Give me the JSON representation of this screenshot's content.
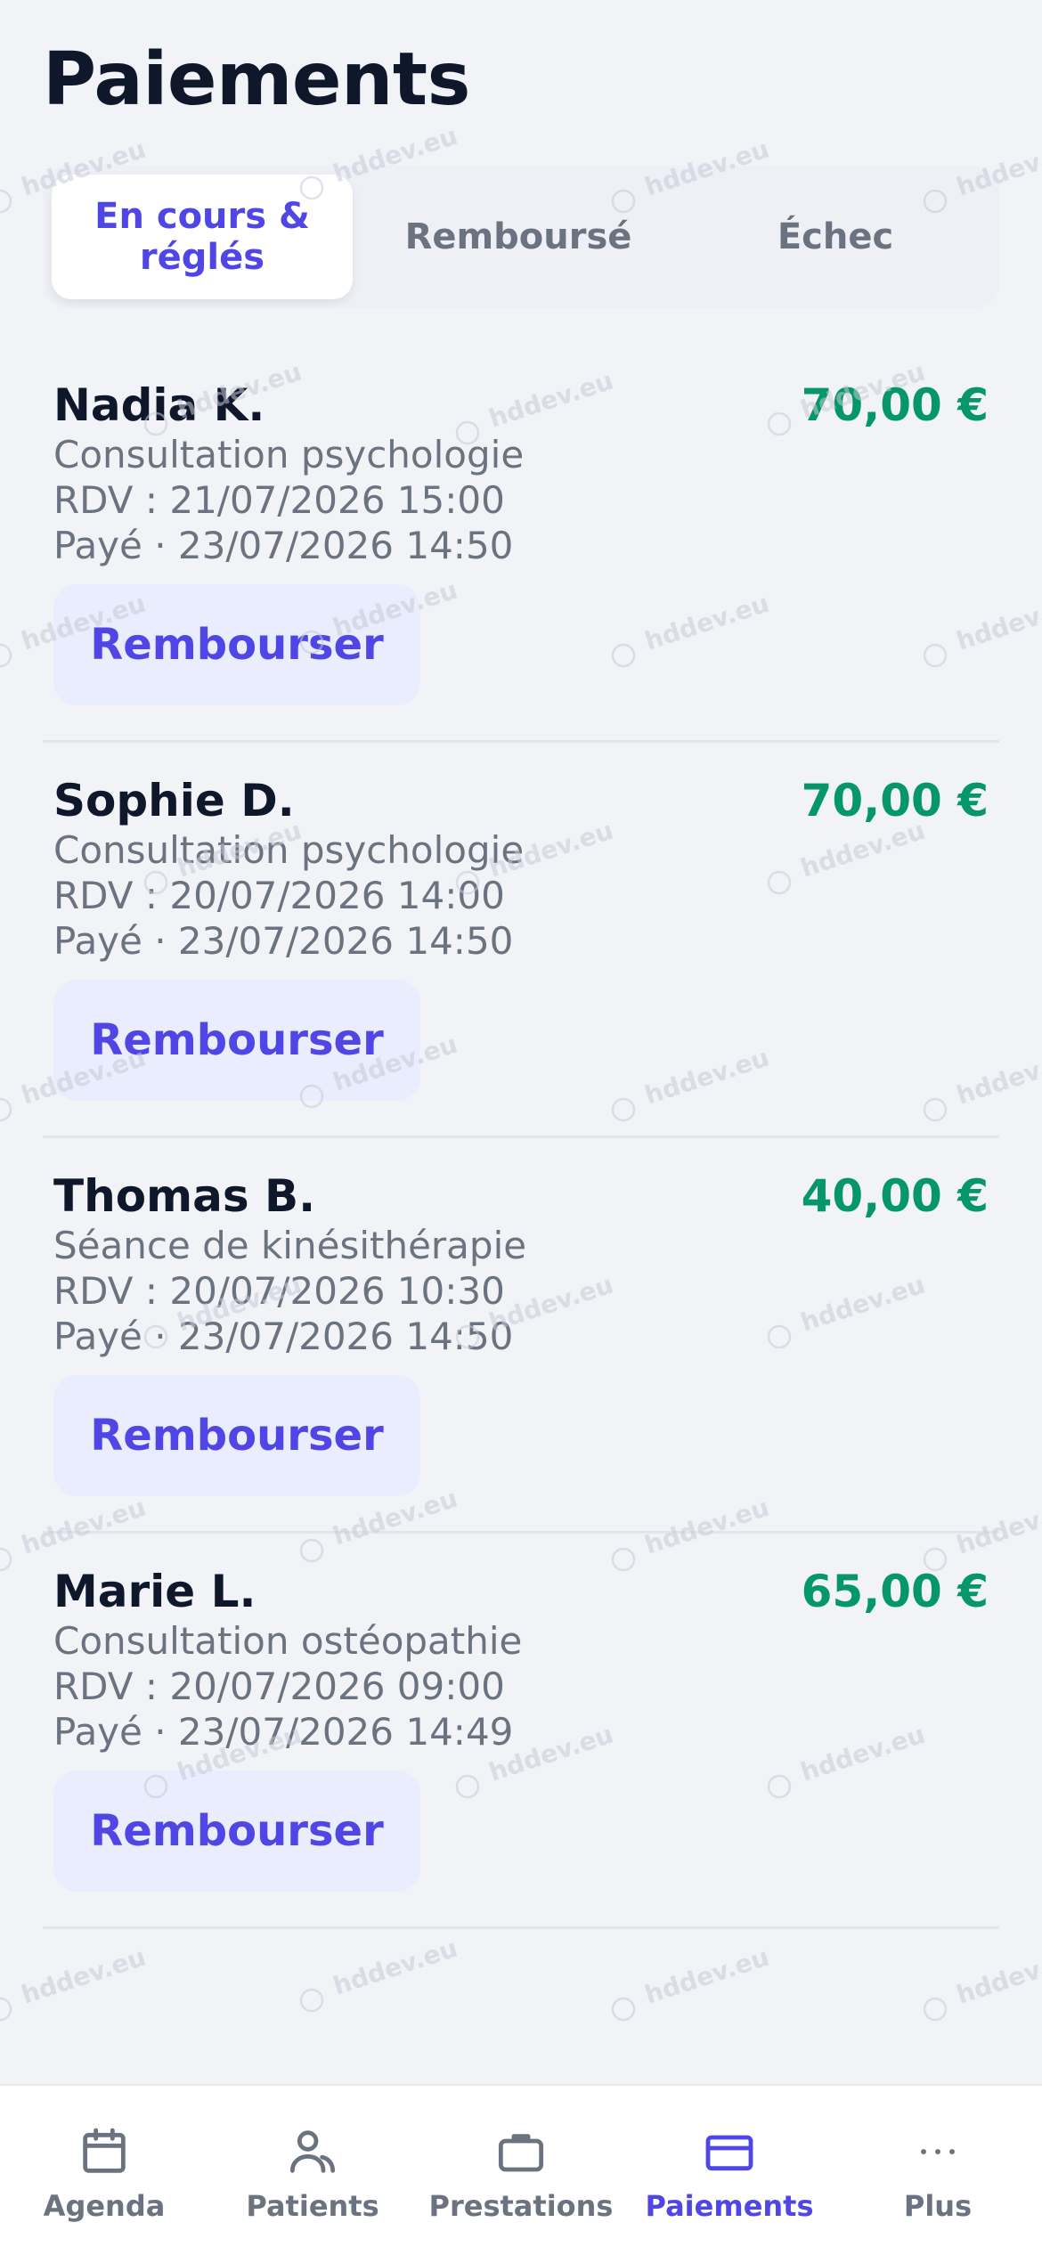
{
  "header": {
    "title": "Paiements"
  },
  "tabs": [
    {
      "label": "En cours &\nréglés",
      "active": true
    },
    {
      "label": "Remboursé",
      "active": false
    },
    {
      "label": "Échec",
      "active": false
    }
  ],
  "payments": [
    {
      "name": "Nadia K.",
      "amount": "70,00 €",
      "service": "Consultation psychologie",
      "appointment": "RDV : 21/07/2026 15:00",
      "paid": "Payé · 23/07/2026 14:50",
      "action": "Rembourser"
    },
    {
      "name": "Sophie D.",
      "amount": "70,00 €",
      "service": "Consultation psychologie",
      "appointment": "RDV : 20/07/2026 14:00",
      "paid": "Payé · 23/07/2026 14:50",
      "action": "Rembourser"
    },
    {
      "name": "Thomas B.",
      "amount": "40,00 €",
      "service": "Séance de kinésithérapie",
      "appointment": "RDV : 20/07/2026 10:30",
      "paid": "Payé · 23/07/2026 14:50",
      "action": "Rembourser"
    },
    {
      "name": "Marie L.",
      "amount": "65,00 €",
      "service": "Consultation ostéopathie",
      "appointment": "RDV : 20/07/2026 09:00",
      "paid": "Payé · 23/07/2026 14:49",
      "action": "Rembourser"
    }
  ],
  "tabbar": {
    "items": [
      {
        "label": "Agenda",
        "icon": "calendar-icon",
        "active": false
      },
      {
        "label": "Patients",
        "icon": "user-icon",
        "active": false
      },
      {
        "label": "Prestations",
        "icon": "briefcase-icon",
        "active": false
      },
      {
        "label": "Paiements",
        "icon": "credit-card-icon",
        "active": true
      },
      {
        "label": "Plus",
        "icon": "more-icon",
        "active": false
      }
    ]
  },
  "watermark": "hddev.eu",
  "colors": {
    "accent": "#4f46e5",
    "amount": "#059669",
    "text": "#0f172a",
    "muted": "#6b7280",
    "background": "#f1f3f7",
    "button_bg": "#e9edfd"
  }
}
